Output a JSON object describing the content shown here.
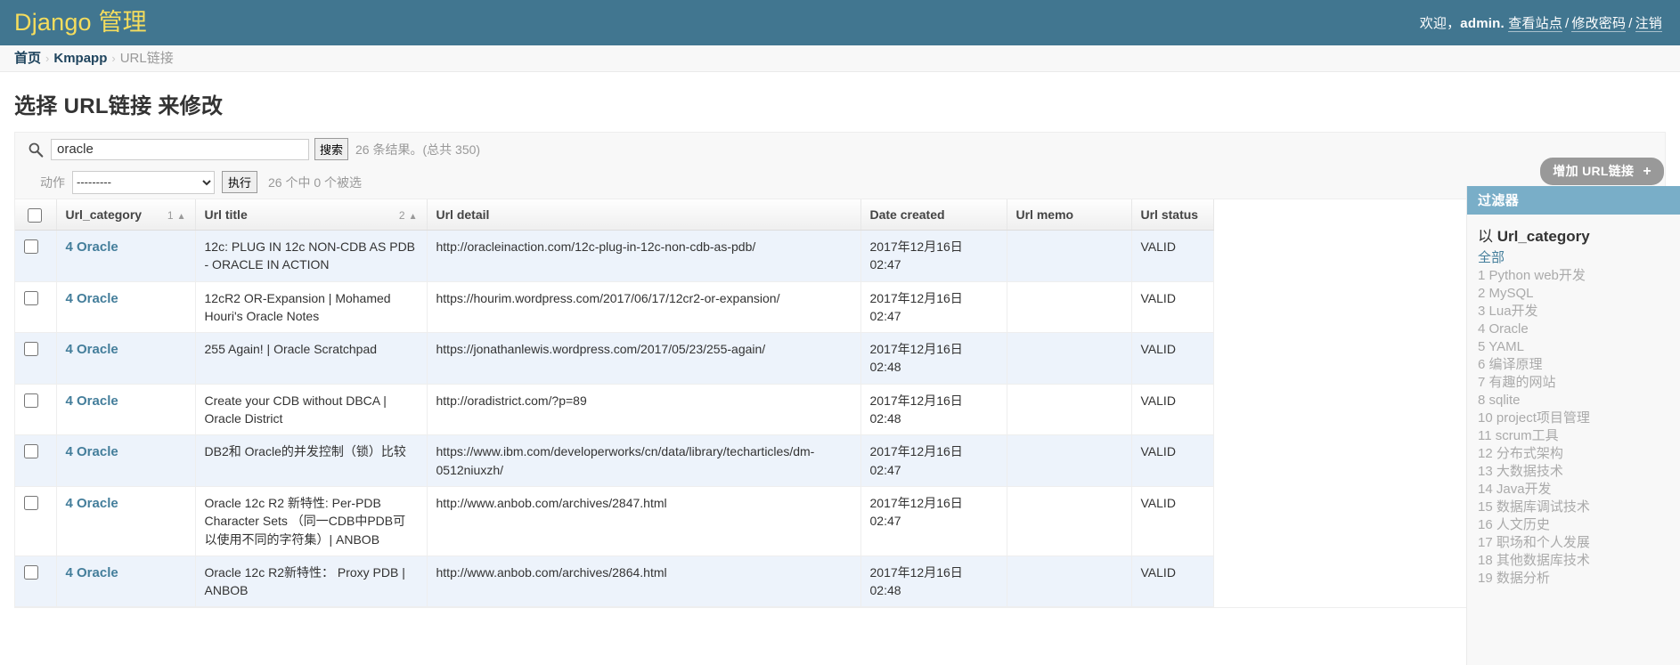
{
  "header": {
    "brand_primary": "Django",
    "brand_secondary": "管理",
    "brand_color": "#f5dd5d",
    "bg_color": "#417690",
    "welcome": "欢迎，",
    "username": "admin.",
    "view_site": "查看站点",
    "sep1": "/",
    "change_password": "修改密码",
    "sep2": "/",
    "logout": "注销"
  },
  "breadcrumbs": {
    "home": "首页",
    "sep1": "›",
    "app": "Kmpapp",
    "sep2": "›",
    "current": "URL链接"
  },
  "page": {
    "title": "选择 URL链接 来修改",
    "add_button": "增加 URL链接",
    "add_button_plus": "+"
  },
  "search": {
    "icon": "search-icon",
    "value": "oracle",
    "placeholder": "",
    "submit_label": "搜索",
    "result_count_text": "26 条结果。(总共 350)"
  },
  "actions": {
    "label": "动作",
    "selected_option": "---------",
    "options": [
      "---------"
    ],
    "go_label": "执行",
    "counter": "26 个中 0 个被选"
  },
  "table": {
    "columns": [
      {
        "key": "check",
        "label": "",
        "sort_priority": "",
        "sort_arrow": ""
      },
      {
        "key": "url_category",
        "label": "Url_category",
        "sort_priority": "1",
        "sort_arrow": "▲"
      },
      {
        "key": "url_title",
        "label": "Url title",
        "sort_priority": "2",
        "sort_arrow": "▲"
      },
      {
        "key": "url_detail",
        "label": "Url detail",
        "sort_priority": "",
        "sort_arrow": ""
      },
      {
        "key": "date_created",
        "label": "Date created",
        "sort_priority": "",
        "sort_arrow": ""
      },
      {
        "key": "url_memo",
        "label": "Url memo",
        "sort_priority": "",
        "sort_arrow": ""
      },
      {
        "key": "url_status",
        "label": "Url status",
        "sort_priority": "",
        "sort_arrow": ""
      }
    ],
    "rows": [
      {
        "url_category": "4 Oracle",
        "url_title": "12c: PLUG IN 12c NON-CDB AS PDB - ORACLE IN ACTION",
        "url_detail": "http://oracleinaction.com/12c-plug-in-12c-non-cdb-as-pdb/",
        "date_created": "2017年12月16日 02:47",
        "url_memo": "",
        "url_status": "VALID"
      },
      {
        "url_category": "4 Oracle",
        "url_title": "12cR2 OR-Expansion | Mohamed Houri's Oracle Notes",
        "url_detail": "https://hourim.wordpress.com/2017/06/17/12cr2-or-expansion/",
        "date_created": "2017年12月16日 02:47",
        "url_memo": "",
        "url_status": "VALID"
      },
      {
        "url_category": "4 Oracle",
        "url_title": "255 Again! | Oracle Scratchpad",
        "url_detail": "https://jonathanlewis.wordpress.com/2017/05/23/255-again/",
        "date_created": "2017年12月16日 02:48",
        "url_memo": "",
        "url_status": "VALID"
      },
      {
        "url_category": "4 Oracle",
        "url_title": "Create your CDB without DBCA | Oracle District",
        "url_detail": "http://oradistrict.com/?p=89",
        "date_created": "2017年12月16日 02:48",
        "url_memo": "",
        "url_status": "VALID"
      },
      {
        "url_category": "4 Oracle",
        "url_title": "DB2和 Oracle的并发控制（锁）比较",
        "url_detail": "https://www.ibm.com/developerworks/cn/data/library/techarticles/dm-0512niuxzh/",
        "date_created": "2017年12月16日 02:47",
        "url_memo": "",
        "url_status": "VALID"
      },
      {
        "url_category": "4 Oracle",
        "url_title": "Oracle 12c R2 新特性: Per-PDB Character Sets （同一CDB中PDB可以使用不同的字符集）| ANBOB",
        "url_detail": "http://www.anbob.com/archives/2847.html",
        "date_created": "2017年12月16日 02:47",
        "url_memo": "",
        "url_status": "VALID"
      },
      {
        "url_category": "4 Oracle",
        "url_title": "Oracle 12c R2新特性： Proxy PDB | ANBOB",
        "url_detail": "http://www.anbob.com/archives/2864.html",
        "date_created": "2017年12月16日 02:48",
        "url_memo": "",
        "url_status": "VALID"
      }
    ]
  },
  "filter": {
    "heading": "过滤器",
    "group_prefix": "以",
    "group_field": "Url_category",
    "items": [
      {
        "label": "全部",
        "selected": true
      },
      {
        "label": "1 Python web开发",
        "selected": false
      },
      {
        "label": "2 MySQL",
        "selected": false
      },
      {
        "label": "3 Lua开发",
        "selected": false
      },
      {
        "label": "4 Oracle",
        "selected": false
      },
      {
        "label": "5 YAML",
        "selected": false
      },
      {
        "label": "6 编译原理",
        "selected": false
      },
      {
        "label": "7 有趣的网站",
        "selected": false
      },
      {
        "label": "8 sqlite",
        "selected": false
      },
      {
        "label": "10 project项目管理",
        "selected": false
      },
      {
        "label": "11 scrum工具",
        "selected": false
      },
      {
        "label": "12 分布式架构",
        "selected": false
      },
      {
        "label": "13 大数据技术",
        "selected": false
      },
      {
        "label": "14 Java开发",
        "selected": false
      },
      {
        "label": "15 数据库调试技术",
        "selected": false
      },
      {
        "label": "16 人文历史",
        "selected": false
      },
      {
        "label": "17 职场和个人发展",
        "selected": false
      },
      {
        "label": "18 其他数据库技术",
        "selected": false
      },
      {
        "label": "19 数据分析",
        "selected": false
      }
    ]
  }
}
